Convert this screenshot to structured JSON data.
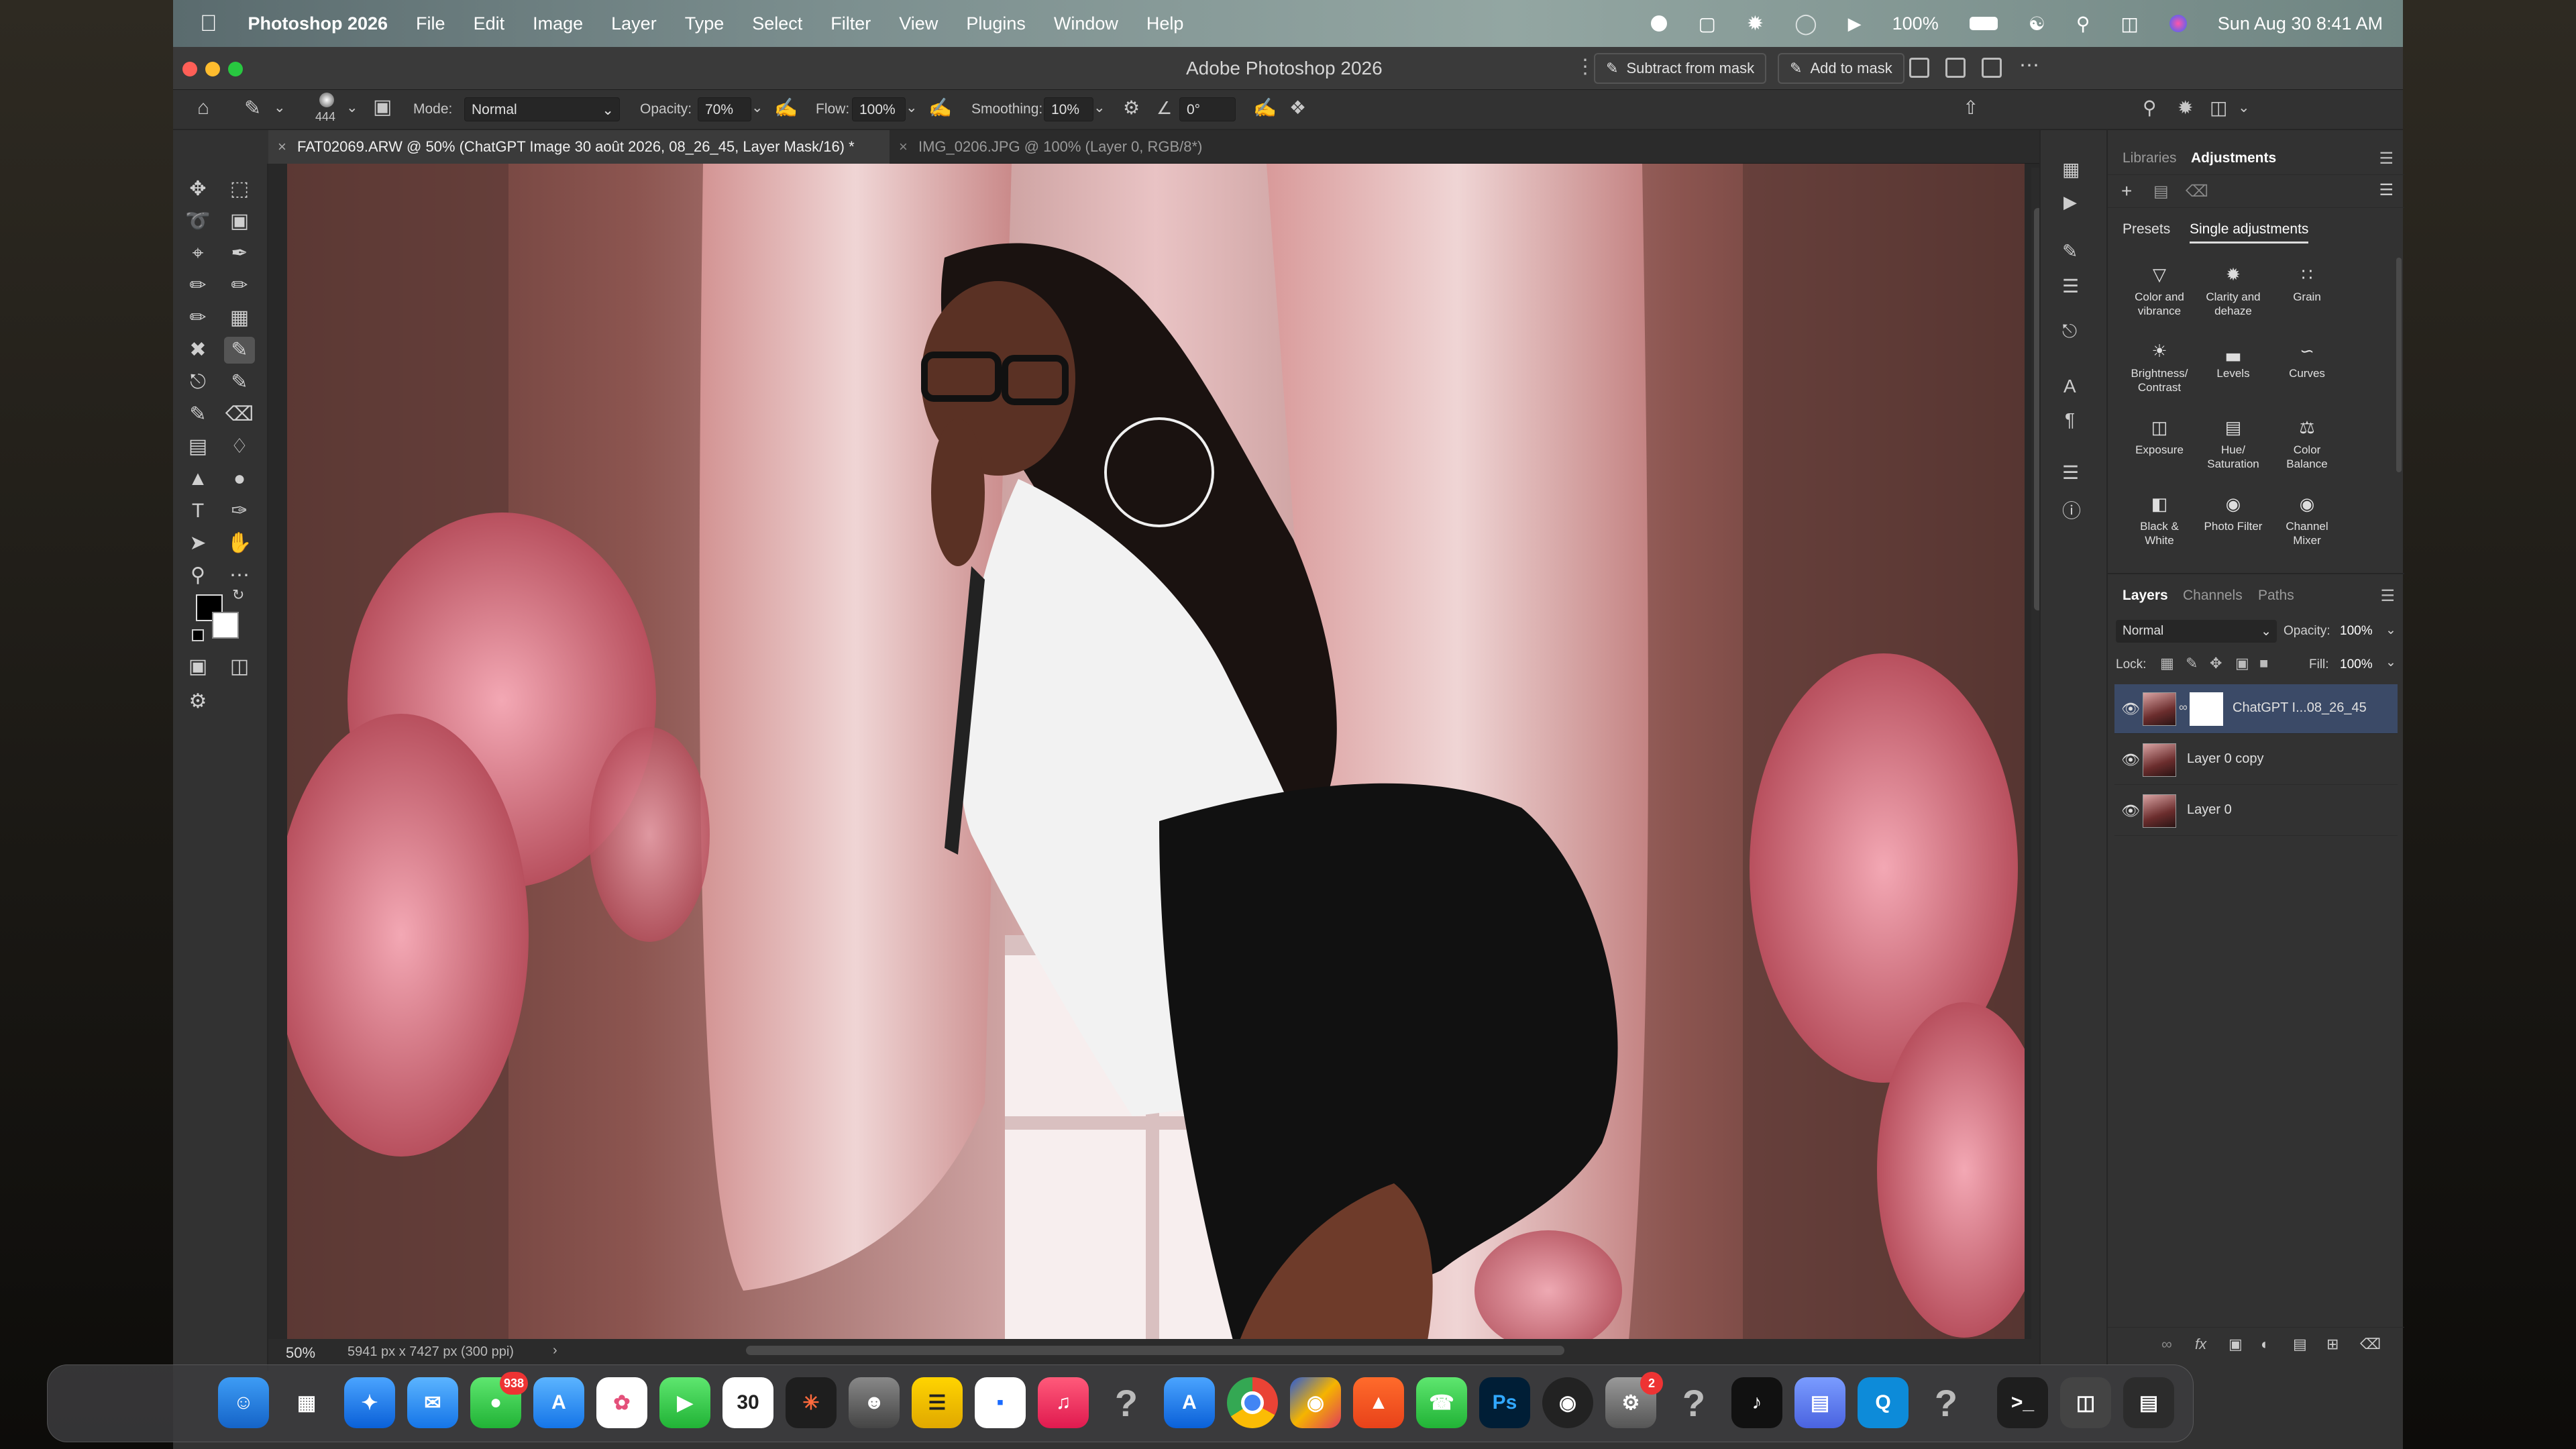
{
  "menubar": {
    "app_name": "Photoshop 2026",
    "items": [
      "File",
      "Edit",
      "Image",
      "Layer",
      "Type",
      "Select",
      "Filter",
      "View",
      "Plugins",
      "Window",
      "Help"
    ],
    "battery": "100%",
    "datetime": "Sun Aug 30  8:41 AM"
  },
  "window": {
    "title": "Adobe Photoshop 2026",
    "subtract_from_mask": "Subtract from mask",
    "add_to_mask": "Add to mask"
  },
  "options": {
    "brush_size": "444",
    "mode_label": "Mode:",
    "mode_value": "Normal",
    "opacity_label": "Opacity:",
    "opacity_value": "70%",
    "flow_label": "Flow:",
    "flow_value": "100%",
    "smoothing_label": "Smoothing:",
    "smoothing_value": "10%",
    "angle_value": "0°"
  },
  "tabs": [
    {
      "label": "FAT02069.ARW @ 50% (ChatGPT Image 30 août 2026, 08_26_45, Layer Mask/16) *"
    },
    {
      "label": "IMG_0206.JPG @ 100% (Layer 0, RGB/8*)"
    }
  ],
  "status": {
    "zoom": "50%",
    "doc_size": "5941 px x 7427 px (300 ppi)"
  },
  "panel": {
    "tabs": [
      "Libraries",
      "Adjustments"
    ],
    "sub_tabs": [
      "Presets",
      "Single adjustments"
    ],
    "adjustments": [
      [
        "Color and",
        "vibrance"
      ],
      [
        "Clarity and",
        "dehaze"
      ],
      [
        "Grain",
        ""
      ],
      [
        "Brightness/",
        "Contrast"
      ],
      [
        "Levels",
        ""
      ],
      [
        "Curves",
        ""
      ],
      [
        "Exposure",
        ""
      ],
      [
        "Hue/",
        "Saturation"
      ],
      [
        "Color",
        "Balance"
      ],
      [
        "Black &",
        "White"
      ],
      [
        "Photo Filter",
        ""
      ],
      [
        "Channel",
        "Mixer"
      ]
    ],
    "layers_tabs": [
      "Layers",
      "Channels",
      "Paths"
    ],
    "blend_mode": "Normal",
    "opacity_label": "Opacity:",
    "opacity_value": "100%",
    "lock_label": "Lock:",
    "fill_label": "Fill:",
    "fill_value": "100%",
    "layers": [
      "ChatGPT I...08_26_45",
      "Layer 0 copy",
      "Layer 0"
    ]
  },
  "dock": {
    "messages_badge": "938",
    "settings_badge": "2",
    "calendar_day": "30"
  },
  "colors": {
    "accent": "#3b4a67",
    "panel_bg": "#323232",
    "canvas_bg": "#282828"
  }
}
